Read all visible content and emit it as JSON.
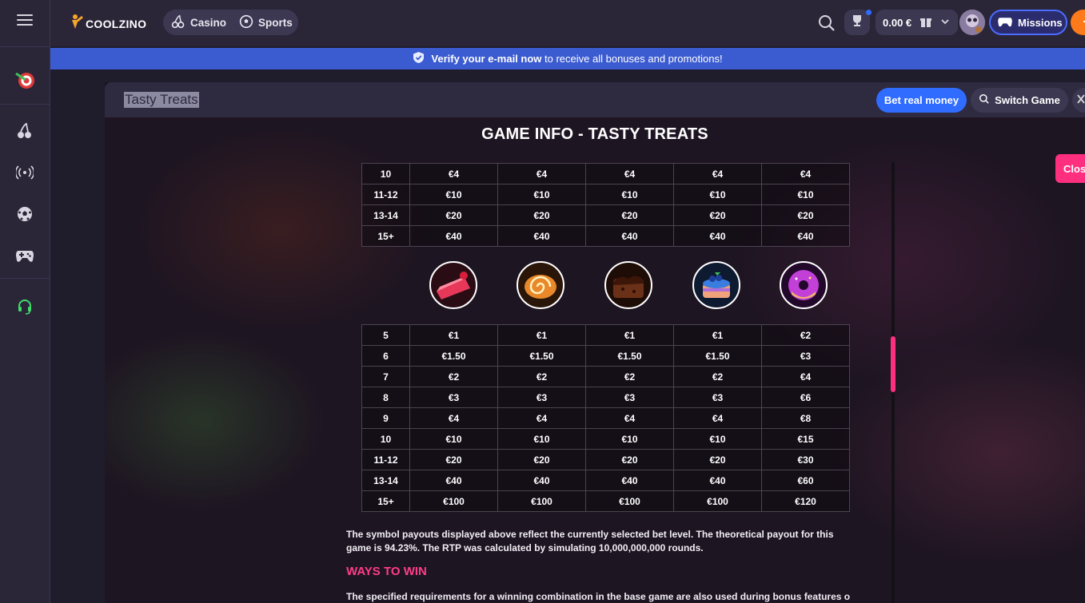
{
  "topbar": {
    "brand": "COOLZINO",
    "nav": [
      {
        "label": "Casino",
        "icon": "cherry-icon"
      },
      {
        "label": "Sports",
        "icon": "soccer-ball-icon"
      }
    ],
    "balance": "0.00 €",
    "missions_label": "Missions"
  },
  "sidebar": {
    "items": [
      "promotions-target-icon",
      "casino-cherry-icon",
      "live-broadcast-icon",
      "sports-ball-icon",
      "games-controller-icon",
      "support-headset-icon"
    ]
  },
  "banner": {
    "bold": "Verify your e-mail now",
    "text": " to receive all bonuses and promotions!"
  },
  "game": {
    "title": "Tasty Treats",
    "bet_real_label": "Bet real money",
    "switch_label": "Switch Game",
    "close_label": "Clos"
  },
  "info": {
    "heading": "GAME INFO - TASTY TREATS",
    "table_top": [
      [
        "10",
        "€4",
        "€4",
        "€4",
        "€4",
        "€4"
      ],
      [
        "11-12",
        "€10",
        "€10",
        "€10",
        "€10",
        "€10"
      ],
      [
        "13-14",
        "€20",
        "€20",
        "€20",
        "€20",
        "€20"
      ],
      [
        "15+",
        "€40",
        "€40",
        "€40",
        "€40",
        "€40"
      ]
    ],
    "symbols": [
      {
        "name": "strawberry-cake-slice",
        "color": "#e8385a"
      },
      {
        "name": "cinnamon-roll",
        "color": "#e8882a"
      },
      {
        "name": "chocolate-brownie",
        "color": "#6b3118"
      },
      {
        "name": "blueberry-cake",
        "color": "#3a7de0"
      },
      {
        "name": "purple-donut",
        "color": "#c23fd8"
      }
    ],
    "table_bottom": [
      [
        "5",
        "€1",
        "€1",
        "€1",
        "€1",
        "€2"
      ],
      [
        "6",
        "€1.50",
        "€1.50",
        "€1.50",
        "€1.50",
        "€3"
      ],
      [
        "7",
        "€2",
        "€2",
        "€2",
        "€2",
        "€4"
      ],
      [
        "8",
        "€3",
        "€3",
        "€3",
        "€3",
        "€6"
      ],
      [
        "9",
        "€4",
        "€4",
        "€4",
        "€4",
        "€8"
      ],
      [
        "10",
        "€10",
        "€10",
        "€10",
        "€10",
        "€15"
      ],
      [
        "11-12",
        "€20",
        "€20",
        "€20",
        "€20",
        "€30"
      ],
      [
        "13-14",
        "€40",
        "€40",
        "€40",
        "€40",
        "€60"
      ],
      [
        "15+",
        "€100",
        "€100",
        "€100",
        "€100",
        "€120"
      ]
    ],
    "rtp_text": "The symbol payouts displayed above reflect the currently selected bet level. The theoretical payout for this game is 94.23%. The RTP was calculated by simulating 10,000,000,000 rounds.",
    "ways_heading": "WAYS TO WIN",
    "ways_text": "The specified requirements for a winning combination in the base game are also used during bonus features or free"
  }
}
